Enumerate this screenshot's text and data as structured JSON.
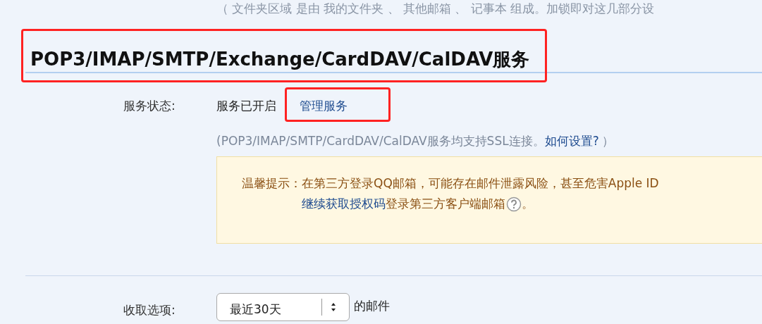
{
  "folder_note": "（ 文件夹区域 是由 我的文件夹 、 其他邮箱 、 记事本 组成。加锁即对这几部分设",
  "section_title": "POP3/IMAP/SMTP/Exchange/CardDAV/CalDAV服务",
  "service_status": {
    "label": "服务状态:",
    "value": "服务已开启",
    "link": "管理服务"
  },
  "ssl_note": {
    "text": "(POP3/IMAP/SMTP/CardDAV/CalDAV服务均支持SSL连接。",
    "link": "如何设置?",
    "close": "）"
  },
  "warning": {
    "label": "温馨提示：",
    "line1": "在第三方登录QQ邮箱，可能存在邮件泄露风险，甚至危害Apple ID",
    "link": "继续获取授权码",
    "line2": "登录第三方客户端邮箱",
    "end": "。"
  },
  "fetch_option": {
    "label": "收取选项:",
    "value": "最近30天",
    "suffix": "的邮件"
  }
}
